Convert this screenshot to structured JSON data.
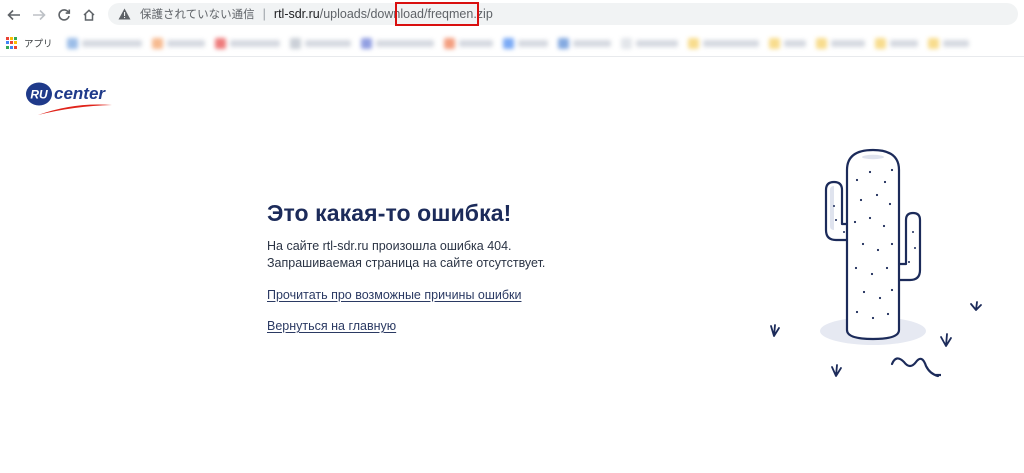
{
  "browser": {
    "security_text": "保護されていない通信",
    "url_host": "rtl-sdr.ru",
    "url_path": "/uploads/download",
    "url_file": "/freqmen.zip",
    "apps_label": "アプリ"
  },
  "page": {
    "logo": {
      "ru": "RU",
      "center": "center"
    },
    "title": "Это какая-то ошибка!",
    "message_line1": "На сайте rtl-sdr.ru произошла ошибка 404.",
    "message_line2": "Запрашиваемая страница на сайте отсутствует.",
    "link_reasons": "Прочитать про возможные причины ошибки",
    "link_home": "Вернуться на главную"
  },
  "colors": {
    "title": "#1c2b5a",
    "logo_blue": "#1f3a8a",
    "logo_red": "#e0241b",
    "highlight": "#d90f0f"
  }
}
